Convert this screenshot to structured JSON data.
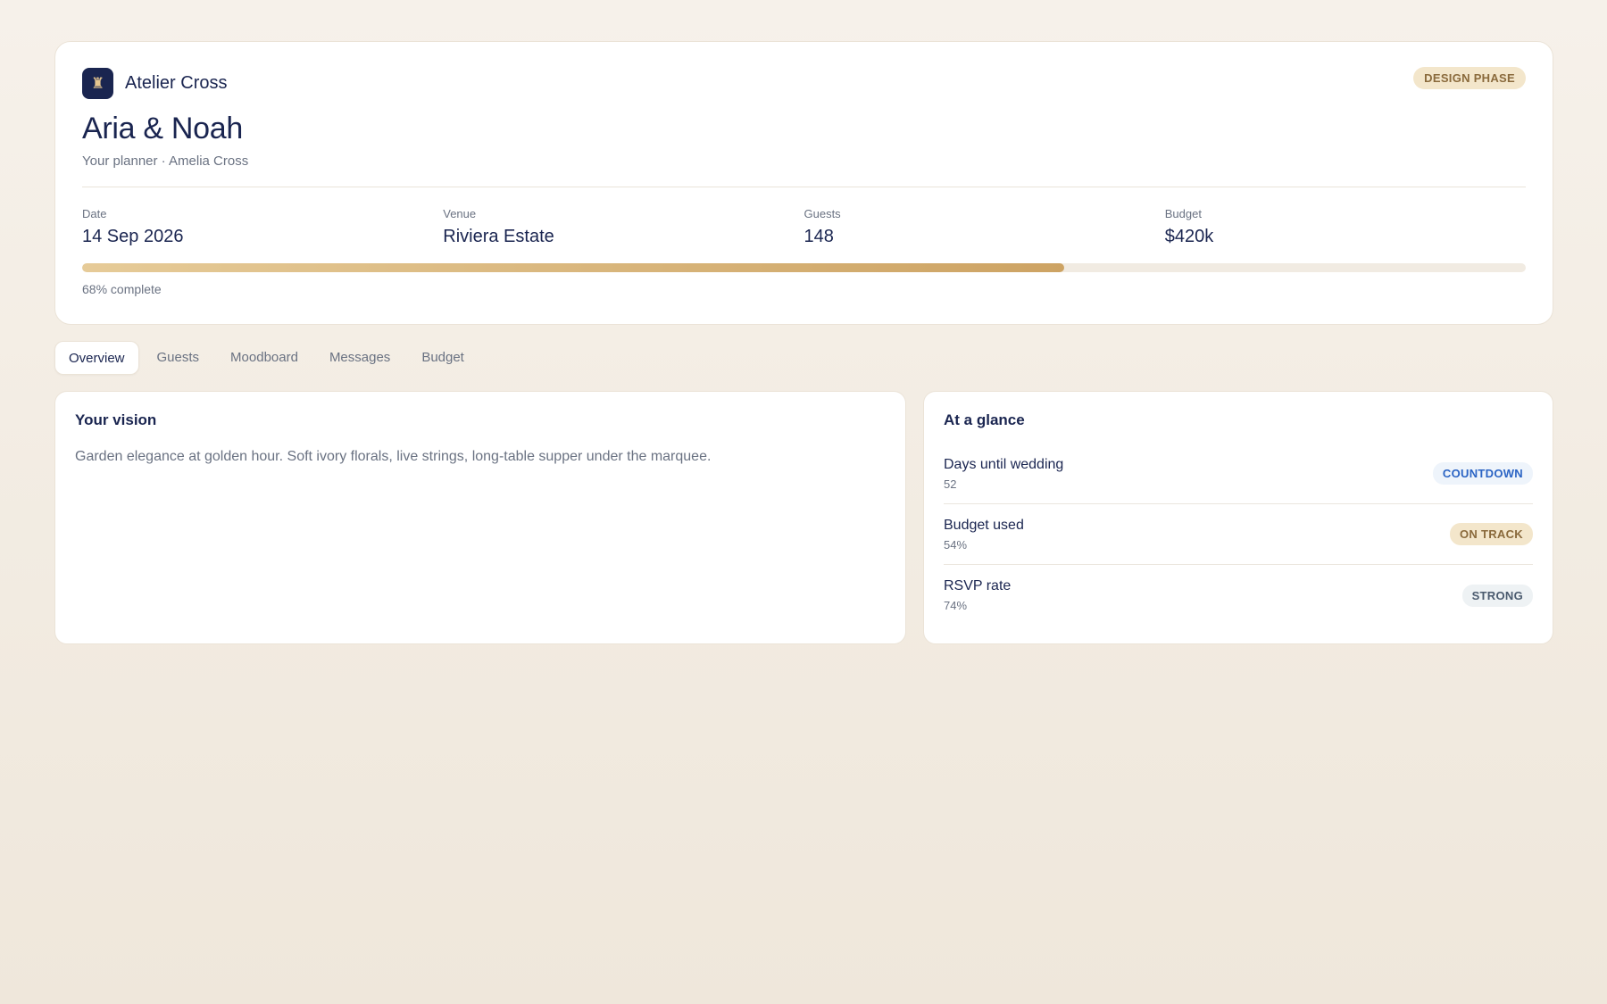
{
  "brand": {
    "name": "Atelier Cross",
    "logo_icon": "cake-icon",
    "logo_glyph": "♜"
  },
  "header": {
    "phase_badge": "DESIGN PHASE",
    "couple": "Aria & Noah",
    "planner": "Your planner · Amelia Cross"
  },
  "stats": [
    {
      "label": "Date",
      "value": "14 Sep 2026"
    },
    {
      "label": "Venue",
      "value": "Riviera Estate"
    },
    {
      "label": "Guests",
      "value": "148"
    },
    {
      "label": "Budget",
      "value": "$420k"
    }
  ],
  "progress": {
    "percent": 68,
    "label": "68% complete"
  },
  "tabs": [
    {
      "label": "Overview",
      "active": true
    },
    {
      "label": "Guests",
      "active": false
    },
    {
      "label": "Moodboard",
      "active": false
    },
    {
      "label": "Messages",
      "active": false
    },
    {
      "label": "Budget",
      "active": false
    }
  ],
  "vision": {
    "title": "Your vision",
    "text": "Garden elegance at golden hour. Soft ivory florals, live strings, long-table supper under the marquee."
  },
  "glance": {
    "title": "At a glance",
    "items": [
      {
        "label": "Days until wedding",
        "value": "52",
        "badge": "COUNTDOWN",
        "badge_bg": "#eef4fb",
        "badge_fg": "#2b64c4"
      },
      {
        "label": "Budget used",
        "value": "54%",
        "badge": "ON TRACK",
        "badge_bg": "#f3e6cb",
        "badge_fg": "#8a6a3c"
      },
      {
        "label": "RSVP rate",
        "value": "74%",
        "badge": "STRONG",
        "badge_bg": "#eef2f4",
        "badge_fg": "#4a5a6e"
      }
    ]
  },
  "colors": {
    "navy": "#1a2550",
    "gold": "#cda363",
    "muted": "#6a7282"
  }
}
